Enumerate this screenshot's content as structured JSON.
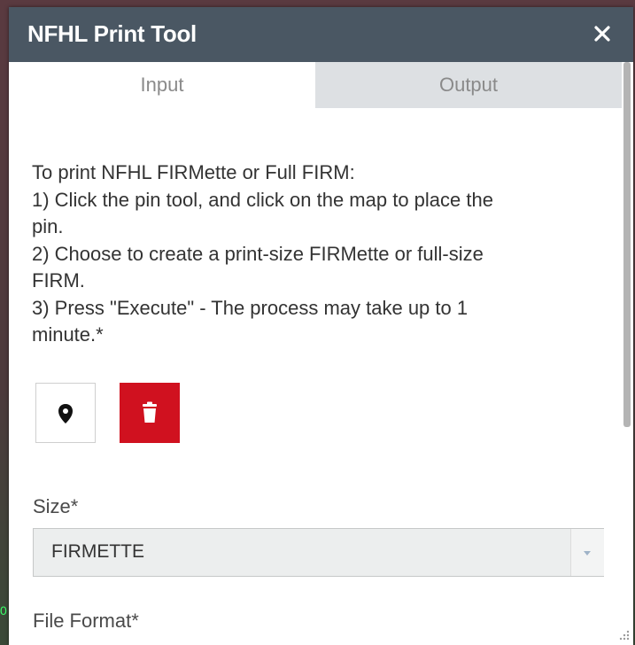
{
  "window": {
    "title": "NFHL Print Tool"
  },
  "tabs": [
    {
      "label": "Input",
      "selected": true
    },
    {
      "label": "Output",
      "selected": false
    }
  ],
  "instructions": [
    "To print NFHL FIRMette or Full FIRM:",
    "1) Click the pin tool, and click on the map to place the",
    "pin.",
    "2) Choose to create a print-size FIRMette or full-size",
    "FIRM.",
    "3) Press \"Execute\" - The process may take up to 1",
    "minute.*"
  ],
  "icons": {
    "close": "close-icon",
    "pin": "map-pin-icon",
    "delete": "trash-icon",
    "dropdown": "chevron-down-icon"
  },
  "form": {
    "size_label": "Size*",
    "size_value": "FIRMETTE",
    "file_format_label": "File Format*"
  },
  "map": {
    "edge_mark": "0"
  },
  "colors": {
    "titlebar": "#4a5763",
    "delete_button": "#d0111f",
    "tab_inactive": "#dde0e3"
  }
}
